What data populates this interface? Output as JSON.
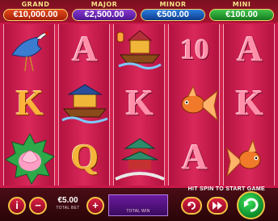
{
  "jackpots": [
    {
      "title": "GRAND",
      "value": "€10,000.00"
    },
    {
      "title": "MAJOR",
      "value": "€2,500.00"
    },
    {
      "title": "MINOR",
      "value": "€500.00"
    },
    {
      "title": "MINI",
      "value": "€100.00"
    }
  ],
  "reels": [
    [
      "crane",
      "K",
      "lotus"
    ],
    [
      "A",
      "boat",
      "Q"
    ],
    [
      "lantern-boat",
      "K",
      "pagoda"
    ],
    [
      "10",
      "goldfish",
      "A"
    ],
    [
      "A",
      "K",
      "goldfish"
    ]
  ],
  "controls": {
    "info_label": "i",
    "minus_label": "−",
    "bet_value": "€5.00",
    "bet_caption": "TOTAL BET",
    "plus_label": "+",
    "win_caption": "TOTAL WIN",
    "hint": "HIT SPIN TO START GAME"
  },
  "colors": {
    "background": "#c9184a",
    "gold": "#f3c542",
    "spin": "#1fb83e"
  }
}
